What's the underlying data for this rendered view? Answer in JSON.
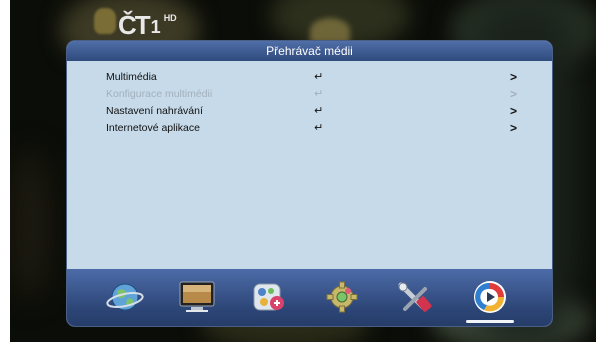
{
  "channel": {
    "logo_text": "ČT",
    "number": "1",
    "badge": "HD"
  },
  "panel": {
    "title": "Přehrávač médii",
    "menu": [
      {
        "label": "Multimédia",
        "enter_icon": "enter-icon",
        "arrow": ">",
        "enabled": true
      },
      {
        "label": "Konfigurace multimédii",
        "enter_icon": "enter-icon",
        "arrow": ">",
        "enabled": false
      },
      {
        "label": "Nastavení nahrávání",
        "enter_icon": "enter-icon",
        "arrow": ">",
        "enabled": true
      },
      {
        "label": "Internetové aplikace",
        "enter_icon": "enter-icon",
        "arrow": ">",
        "enabled": true
      }
    ],
    "enter_symbol": "↵"
  },
  "dock": {
    "items": [
      {
        "icon": "globe-icon"
      },
      {
        "icon": "monitor-icon"
      },
      {
        "icon": "settings-panel-icon"
      },
      {
        "icon": "gear-icon"
      },
      {
        "icon": "satellite-tools-icon"
      },
      {
        "icon": "media-player-icon",
        "active": true
      }
    ]
  },
  "colors": {
    "panel_bg": "#c6dae9",
    "title_bar": "#3d5a8f",
    "dock_bg": "#2d4677",
    "disabled_text": "#a4b0bc"
  }
}
